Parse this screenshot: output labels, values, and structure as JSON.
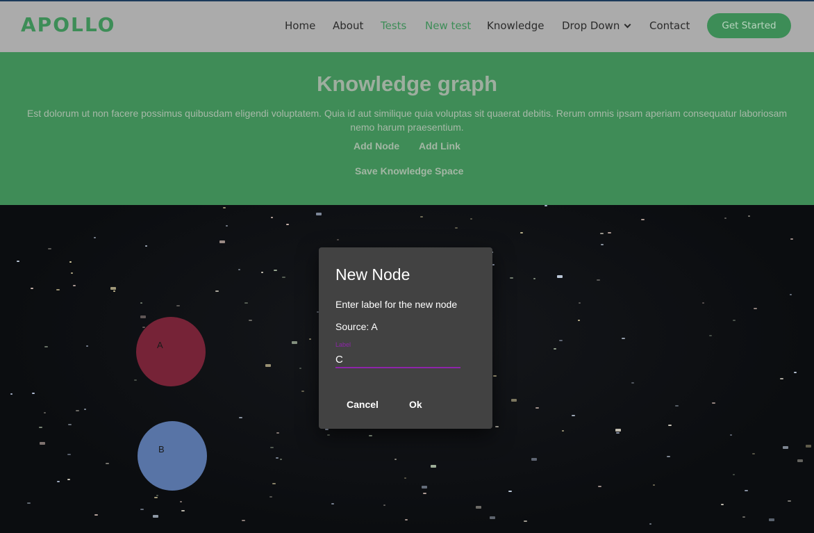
{
  "brand": "APOLLO",
  "nav": {
    "items": [
      "Home",
      "About",
      "Tests",
      "New test",
      "Knowledge",
      "Drop Down",
      "Contact"
    ],
    "cta": "Get Started"
  },
  "hero": {
    "title": "Knowledge graph",
    "description": "Est dolorum ut non facere possimus quibusdam eligendi voluptatem. Quia id aut similique quia voluptas sit quaerat debitis. Rerum omnis ipsam aperiam consequatur laboriosam nemo harum praesentium.",
    "actions": [
      "Add Node",
      "Add Link",
      "Save Knowledge Space"
    ]
  },
  "graph": {
    "nodes": [
      {
        "label": "A",
        "color": "#762337"
      },
      {
        "label": "B",
        "color": "#5874a6"
      }
    ]
  },
  "dialog": {
    "title": "New Node",
    "prompt": "Enter label for the new node",
    "source": "Source: A",
    "field_label": "Label",
    "field_value": "C",
    "cancel": "Cancel",
    "ok": "Ok"
  },
  "colors": {
    "brand_green": "#3d8d57",
    "navbar_bg": "#ababab",
    "dialog_bg": "#424242",
    "field_accent": "#8e24aa"
  }
}
